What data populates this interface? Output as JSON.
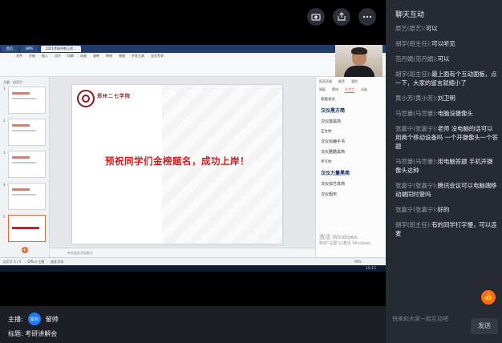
{
  "top_icons": [
    "camera-switch-icon",
    "share-icon",
    "more-icon"
  ],
  "wps": {
    "tabs": [
      "首页",
      "WPS",
      "2021考研冲刺上岸..."
    ],
    "menu": [
      "文件",
      "开始",
      "插入",
      "设计",
      "切换",
      "动画",
      "放映",
      "审阅",
      "视图",
      "开发工具",
      "会员专享"
    ],
    "thumb_tabs": [
      "大纲",
      "幻灯片"
    ],
    "thumb_count": 5,
    "selected_thumb": 5,
    "notes_placeholder": "单击此处添加备注",
    "status_items": [
      "幻灯片 5 / 5",
      "Office 主题",
      "缺失字体"
    ],
    "zoom": "95%",
    "time": "10:15"
  },
  "slide": {
    "school": "郑州二七学院",
    "title": "预祝同学们金榜题名，成功上岸！"
  },
  "right_panel": {
    "header": [
      "稻壳资源",
      "推荐",
      "我的"
    ],
    "tabs": [
      "模板",
      "素材",
      "艺术字",
      "动画"
    ],
    "items": [
      "初级会员",
      "汉仪黑方简",
      "汉仪旗黑简",
      "正文体",
      "汉仪尚巍手书",
      "汉仪雅酷黑简",
      "手写体",
      "汉仪力量黑简",
      "汉仪综艺体简",
      "汉仪粗宋"
    ]
  },
  "windows_watermark": {
    "line1": "激活 Windows",
    "line2": "转到\"设置\"以激活 Windows。"
  },
  "host": {
    "label": "主播:",
    "avatar": "留帅",
    "name": "留帅"
  },
  "topic": {
    "label": "标题:",
    "text": "考研讲解会"
  },
  "chat": {
    "title": "聊天互动",
    "messages": [
      {
        "who": "原艺(原艺):",
        "text": "可以"
      },
      {
        "who": "胡宇(班主任):",
        "text": "可以听见"
      },
      {
        "who": "范丹娟(范丹娟):",
        "text": "可以"
      },
      {
        "who": "胡宇(班主任):",
        "text": "最上面有个互动面板，点一下，大家的留言就缩小了"
      },
      {
        "who": "黄小芳(黄小芳):",
        "text": "刘卫明"
      },
      {
        "who": "马世豪(马世豪):",
        "text": "电脑没摄像头"
      },
      {
        "who": "张嘉宁(张嘉宁):",
        "text": "老师 没电脑的话可以用两个移动设备吗 一个开摄像头一个答题"
      },
      {
        "who": "马世豪(马世豪):",
        "text": "用电脑答题 手机开摄像头这种"
      },
      {
        "who": "张嘉宁(张嘉宁):",
        "text": "腾讯会议可以电脑端移动端同时登吗"
      },
      {
        "who": "张嘉宁(张嘉宁):",
        "text": "好的"
      },
      {
        "who": "胡宇(班主任):",
        "text": "有的同学打字慢，可以连麦"
      }
    ],
    "input_placeholder": "快来和大家一起互动吧",
    "send_label": "发送",
    "like_icon": "thumbs-up-icon"
  },
  "colors": {
    "accent": "#1e7bf5",
    "like": "#ff6a1a",
    "slide_title": "#d61a1a"
  }
}
